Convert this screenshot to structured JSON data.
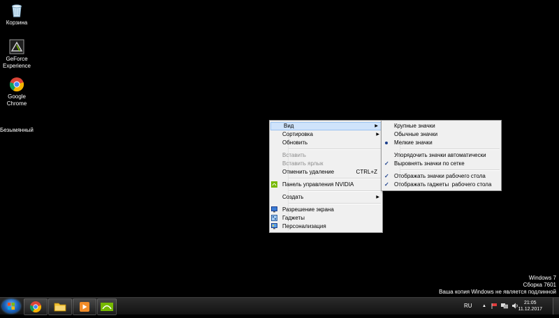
{
  "desktop": {
    "icons": [
      {
        "label": "Корзина"
      },
      {
        "label": "GeForce Experience"
      },
      {
        "label": "Google Chrome"
      },
      {
        "label": "Безымянный"
      }
    ]
  },
  "context_menu": {
    "items": {
      "view": "Вид",
      "sort": "Сортировка",
      "refresh": "Обновить",
      "paste": "Вставить",
      "paste_shortcut": "Вставить ярлык",
      "undo_delete": "Отменить удаление",
      "undo_shortcut": "CTRL+Z",
      "nvidia": "Панель управления NVIDIA",
      "create": "Создать",
      "resolution": "Разрешение экрана",
      "gadgets": "Гаджеты",
      "personalize": "Персонализация"
    }
  },
  "view_submenu": {
    "large": "Крупные значки",
    "medium": "Обычные значки",
    "small": "Мелкие значки",
    "auto_arrange": "Упорядочить значки автоматически",
    "align_grid": "Выровнять значки по сетке",
    "show_icons": "Отображать значки рабочего стола",
    "show_gadgets": "Отображать гаджеты  рабочего стола"
  },
  "watermark": {
    "line1": "Windows 7",
    "line2": "Сборка 7601",
    "line3": "Ваша копия Windows не является подлинной"
  },
  "taskbar": {
    "language": "RU",
    "time": "21:05",
    "date": "11.12.2017"
  },
  "icons": {
    "recycle": "recycle-bin-icon",
    "geforce": "geforce-experience-icon",
    "chrome": "chrome-icon",
    "folder": "folder-icon",
    "media": "media-player-icon",
    "nvidia": "nvidia-icon"
  }
}
